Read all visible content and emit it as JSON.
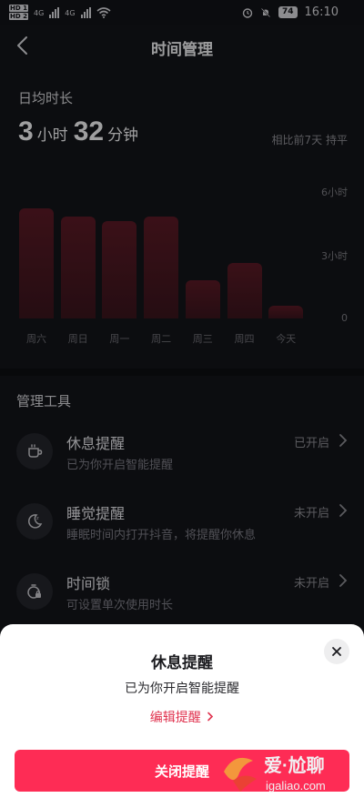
{
  "status_bar": {
    "sim1": "HD 1",
    "sim2": "HD 2",
    "net1": "4G",
    "net2": "4G",
    "battery": "74",
    "time": "16:10"
  },
  "header": {
    "title": "时间管理"
  },
  "average": {
    "label": "日均时长",
    "hours": "3",
    "hours_unit": "小时",
    "minutes": "32",
    "minutes_unit": "分钟",
    "compare": "相比前7天 持平"
  },
  "chart_data": {
    "type": "bar",
    "categories": [
      "周六",
      "周日",
      "周一",
      "周二",
      "周三",
      "周四",
      "今天"
    ],
    "values": [
      5.2,
      4.8,
      4.6,
      4.8,
      1.8,
      2.6,
      0.6
    ],
    "unit": "小时",
    "ylim": [
      0,
      6
    ],
    "yticks": [
      "6小时",
      "3小时",
      "0"
    ],
    "colors": {
      "bar_top": "#5a1a25",
      "bar_bottom": "#3a141d"
    }
  },
  "tools": {
    "title": "管理工具",
    "items": [
      {
        "name": "休息提醒",
        "desc": "已为你开启智能提醒",
        "status": "已开启",
        "icon": "cup-icon"
      },
      {
        "name": "睡觉提醒",
        "desc": "睡眠时间内打开抖音，将提醒你休息",
        "status": "未开启",
        "icon": "moon-icon"
      },
      {
        "name": "时间锁",
        "desc": "可设置单次使用时长",
        "status": "未开启",
        "icon": "timer-lock-icon"
      }
    ]
  },
  "sheet": {
    "title": "休息提醒",
    "desc": "已为你开启智能提醒",
    "edit_link": "编辑提醒",
    "close_button": "关闭提醒"
  },
  "watermark": {
    "brand": "爱·尬聊",
    "url": "igaliao.com"
  },
  "colors": {
    "accent": "#fe2c55",
    "background": "#131419",
    "sheet_background": "#ffffff"
  }
}
